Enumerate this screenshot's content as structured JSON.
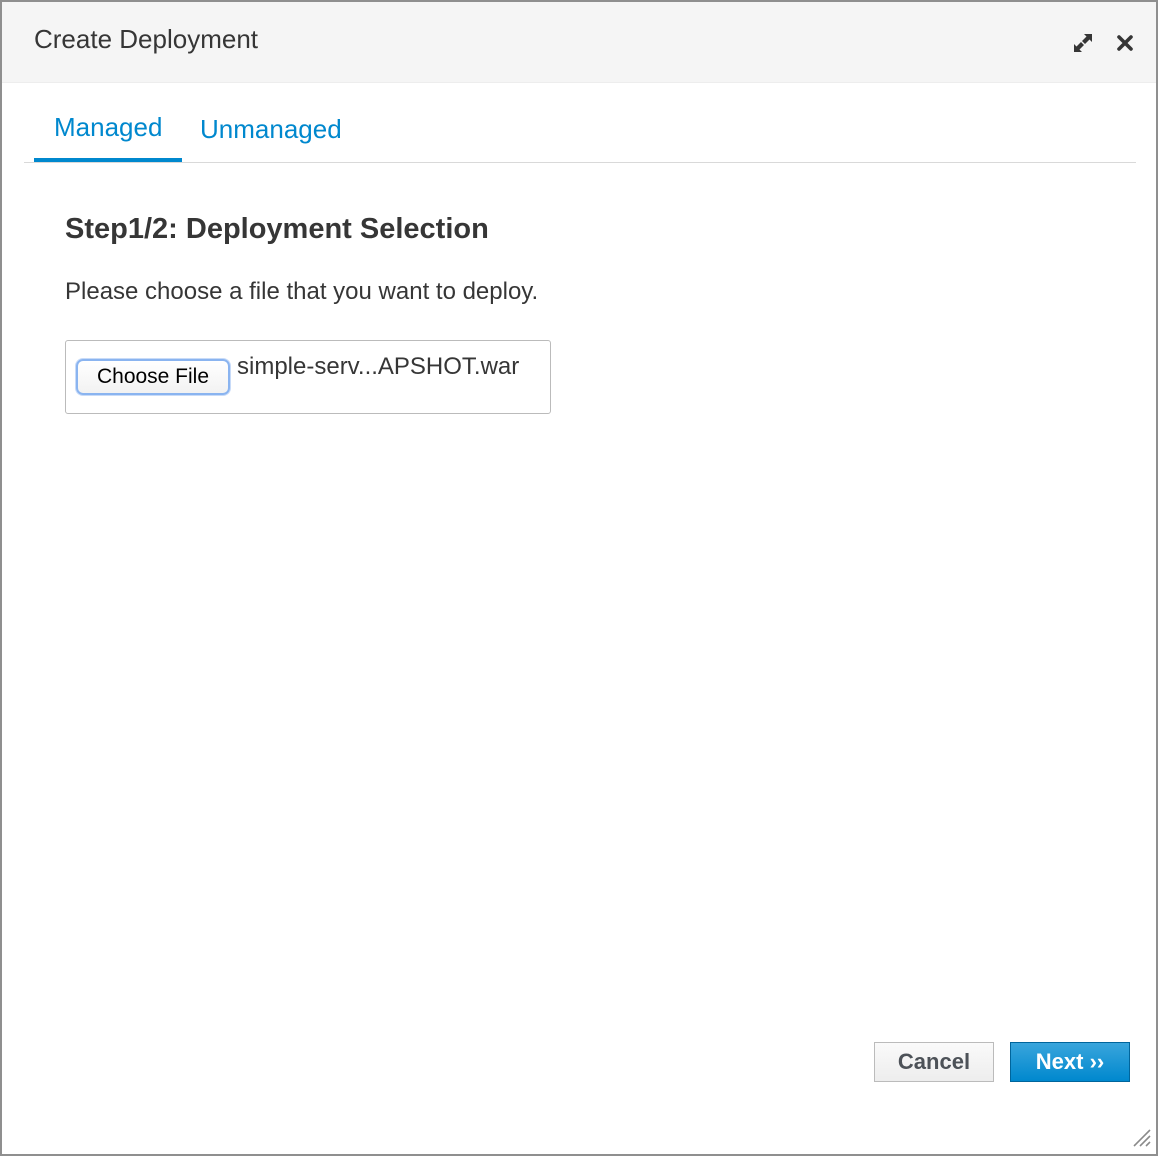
{
  "dialog": {
    "title": "Create Deployment",
    "maximize_icon": "expand-arrows-icon",
    "close_icon": "close-x-icon"
  },
  "tabs": [
    {
      "label": "Managed",
      "active": true
    },
    {
      "label": "Unmanaged",
      "active": false
    }
  ],
  "step": {
    "title": "Step1/2: Deployment Selection",
    "instructions": "Please choose a file that you want to deploy."
  },
  "file_input": {
    "button_label": "Choose File",
    "selected_file": "simple-serv...APSHOT.war"
  },
  "footer": {
    "cancel_label": "Cancel",
    "next_label": "Next ››"
  },
  "colors": {
    "accent": "#0088ce",
    "header_bg": "#f5f5f5",
    "text": "#363636"
  }
}
